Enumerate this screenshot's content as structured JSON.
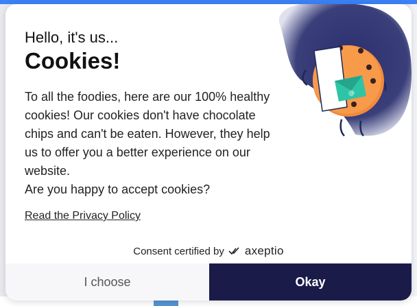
{
  "dialog": {
    "greeting": "Hello, it's us...",
    "title": "Cookies!",
    "body": "To all the foodies, here are our 100% healthy cookies! Our cookies don't have chocolate chips and can't be eaten. However, they help us to offer you a better experience on our website.",
    "question": "Are you happy to accept cookies?",
    "privacy_link": "Read the Privacy Policy",
    "consent_prefix": "Consent certified by",
    "consent_brand": "axeptio",
    "buttons": {
      "choose": "I choose",
      "okay": "Okay"
    }
  },
  "colors": {
    "accent_dark": "#1b1b4a",
    "cookie": "#f28a3c",
    "envelope": "#2ec4a6",
    "blob": "#2b2f6e"
  },
  "icons": {
    "illustration": "cookie-holding-letter-illustration",
    "brand_mark": "axeptio-checkmark-icon"
  }
}
